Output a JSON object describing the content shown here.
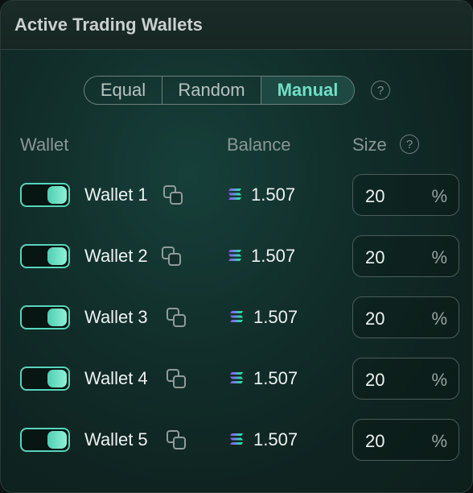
{
  "header": {
    "title": "Active Trading Wallets"
  },
  "mode_selector": {
    "options": [
      "Equal",
      "Random",
      "Manual"
    ],
    "selected": "Manual"
  },
  "columns": {
    "wallet": "Wallet",
    "balance": "Balance",
    "size": "Size"
  },
  "wallets": [
    {
      "name": "Wallet 1",
      "enabled": true,
      "balance": "1.507",
      "size": "20",
      "unit": "%"
    },
    {
      "name": "Wallet 2",
      "enabled": true,
      "balance": "1.507",
      "size": "20",
      "unit": "%"
    },
    {
      "name": "Wallet 3",
      "enabled": true,
      "balance": "1.507",
      "size": "20",
      "unit": "%"
    },
    {
      "name": "Wallet 4",
      "enabled": true,
      "balance": "1.507",
      "size": "20",
      "unit": "%"
    },
    {
      "name": "Wallet 5",
      "enabled": true,
      "balance": "1.507",
      "size": "20",
      "unit": "%"
    }
  ],
  "icons": {
    "help": "question-circle-icon",
    "copy": "copy-icon",
    "currency": "solana-icon"
  },
  "colors": {
    "accent": "#6fe0c6",
    "toggle_on": "#58d4bb"
  }
}
